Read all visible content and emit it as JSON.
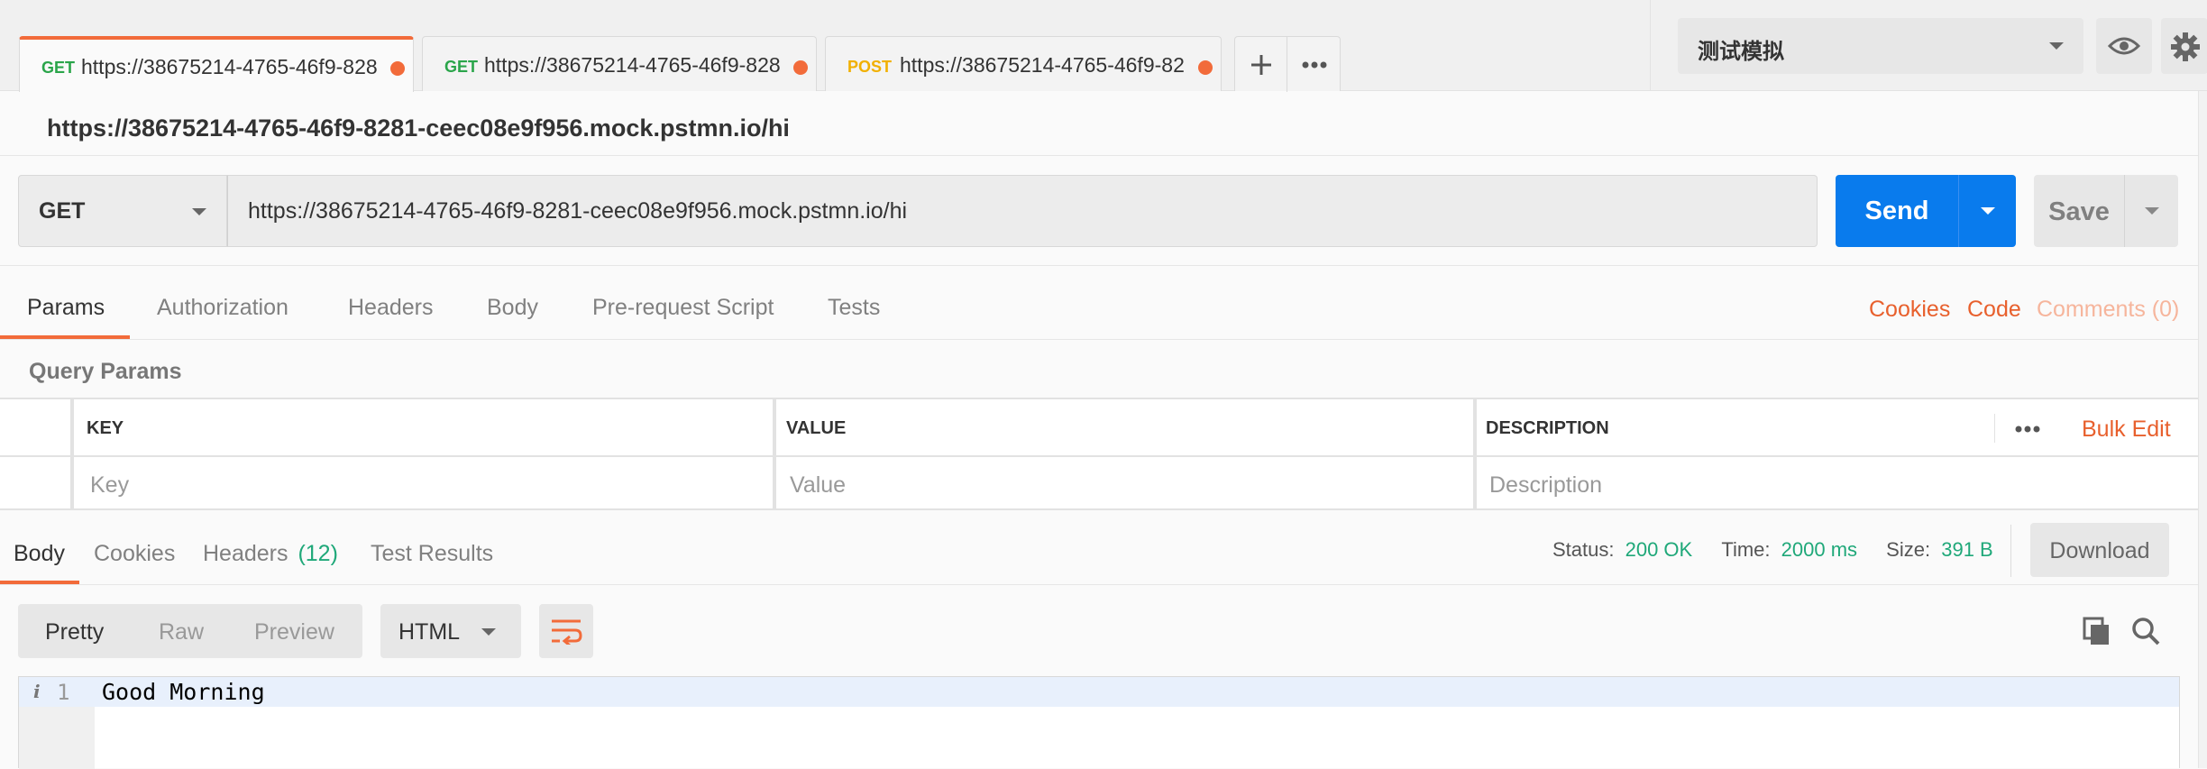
{
  "tabs": [
    {
      "method": "GET",
      "url": "https://38675214-4765-46f9-828",
      "method_color": "#2aa54a"
    },
    {
      "method": "GET",
      "url": "https://38675214-4765-46f9-828",
      "method_color": "#2aa54a"
    },
    {
      "method": "POST",
      "url": "https://38675214-4765-46f9-82",
      "method_color": "#f1b000"
    }
  ],
  "environment": {
    "selected": "测试模拟"
  },
  "request": {
    "title": "https://38675214-4765-46f9-8281-ceec08e9f956.mock.pstmn.io/hi",
    "method": "GET",
    "url": "https://38675214-4765-46f9-8281-ceec08e9f956.mock.pstmn.io/hi",
    "send_label": "Send",
    "save_label": "Save"
  },
  "request_tabs": {
    "items": [
      "Params",
      "Authorization",
      "Headers",
      "Body",
      "Pre-request Script",
      "Tests"
    ],
    "active": "Params",
    "cookies": "Cookies",
    "code": "Code",
    "comments": "Comments (0)"
  },
  "params": {
    "section_title": "Query Params",
    "columns": [
      "KEY",
      "VALUE",
      "DESCRIPTION"
    ],
    "bulk_edit": "Bulk Edit",
    "placeholders": {
      "key": "Key",
      "value": "Value",
      "description": "Description"
    }
  },
  "response": {
    "tabs": [
      "Body",
      "Cookies",
      "Headers",
      "Test Results"
    ],
    "active_tab": "Body",
    "headers_count": "(12)",
    "status_label": "Status:",
    "status_value": "200 OK",
    "time_label": "Time:",
    "time_value": "2000 ms",
    "size_label": "Size:",
    "size_value": "391 B",
    "download_label": "Download",
    "view_modes": [
      "Pretty",
      "Raw",
      "Preview"
    ],
    "active_view": "Pretty",
    "format": "HTML",
    "line_number": "1",
    "line_text": "Good Morning"
  },
  "colors": {
    "accent_orange": "#f26b3a",
    "send_blue": "#097bed",
    "status_green": "#1fa879"
  }
}
